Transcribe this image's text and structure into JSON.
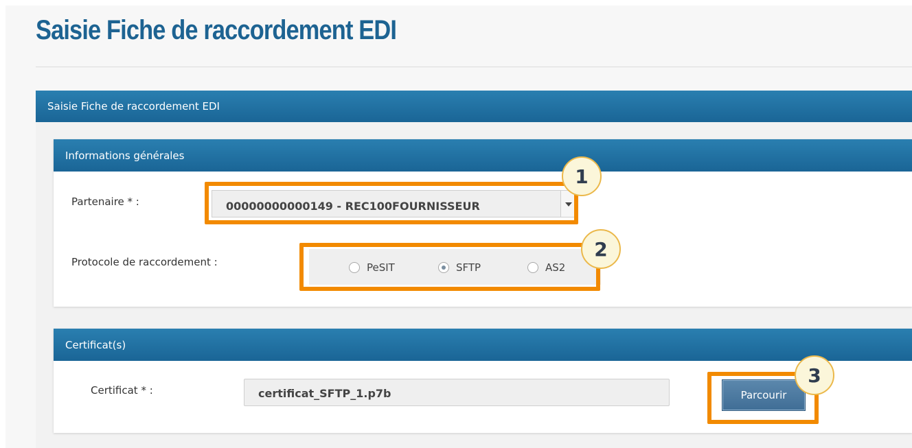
{
  "page": {
    "title": "Saisie Fiche de raccordement EDI"
  },
  "panel": {
    "header": "Saisie Fiche de raccordement EDI"
  },
  "general": {
    "header": "Informations générales",
    "partner_label": "Partenaire * :",
    "partner_value": "00000000000149 - REC100FOURNISSEUR",
    "protocol_label": "Protocole de raccordement :",
    "protocol_options": [
      "PeSIT",
      "SFTP",
      "AS2"
    ],
    "protocol_selected": "SFTP"
  },
  "certificates": {
    "header": "Certificat(s)",
    "certificate_label": "Certificat * :",
    "certificate_value": "certificat_SFTP_1.p7b",
    "browse_label": "Parcourir"
  },
  "callouts": [
    "1",
    "2",
    "3"
  ],
  "colors": {
    "title": "#1d6392",
    "header_bar": "#1f6fa0",
    "highlight": "#f28a00",
    "badge_fill": "#fbf6da",
    "badge_text": "#303d4f"
  }
}
